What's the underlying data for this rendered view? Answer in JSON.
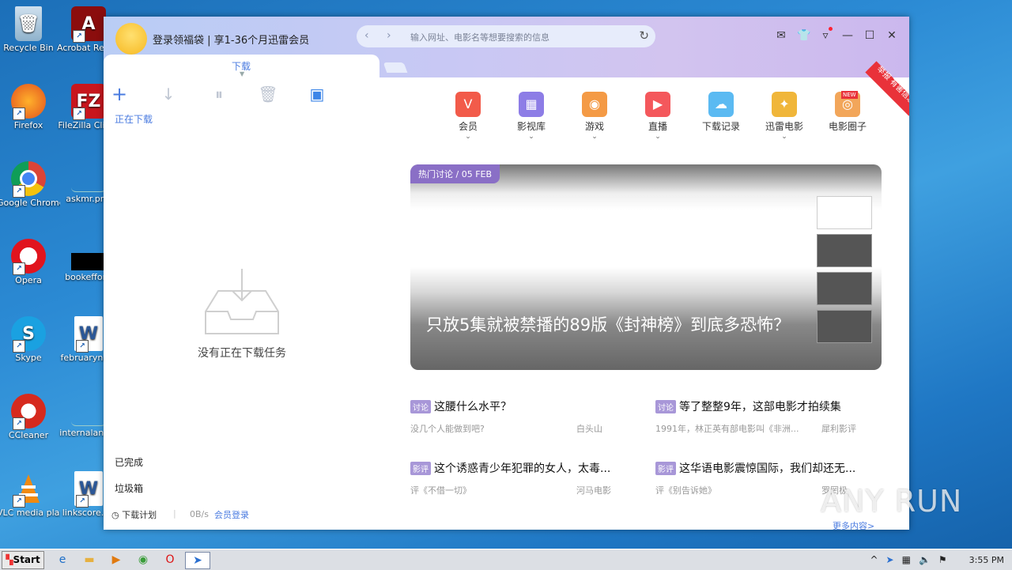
{
  "desktop": {
    "icons": [
      {
        "label": "Recycle Bin",
        "icon": "recycle-bin-icon"
      },
      {
        "label": "Acrobat Reader DC",
        "icon": "acrobat-icon"
      },
      {
        "label": "Firefox",
        "icon": "firefox-icon"
      },
      {
        "label": "FileZilla Client",
        "icon": "filezilla-icon"
      },
      {
        "label": "Google Chrome",
        "icon": "chrome-icon"
      },
      {
        "label": "askmr.png",
        "icon": "image-file-icon"
      },
      {
        "label": "Opera",
        "icon": "opera-icon"
      },
      {
        "label": "bookeffort.",
        "icon": "file-icon"
      },
      {
        "label": "Skype",
        "icon": "skype-icon"
      },
      {
        "label": "februaryna...",
        "icon": "word-doc-icon"
      },
      {
        "label": "CCleaner",
        "icon": "ccleaner-icon"
      },
      {
        "label": "internalang...",
        "icon": "file-icon"
      },
      {
        "label": "VLC media player",
        "icon": "vlc-icon"
      },
      {
        "label": "linkscore.r...",
        "icon": "word-doc-icon"
      }
    ]
  },
  "app": {
    "login_text": "登录领福袋 | 享1-36个月迅雷会员",
    "address_placeholder": "输入网址、电影名等想要搜索的信息",
    "tab_label": "下载",
    "toolbar": {
      "add": "+",
      "more": "•••"
    },
    "sidebar": {
      "active": "正在下载",
      "completed": "已完成",
      "trash": "垃圾箱"
    },
    "empty_text": "没有正在下载任务",
    "bottom": {
      "plan": "下载计划",
      "speed": "0B/s",
      "vip_login": "会员登录"
    },
    "categories": [
      {
        "label": "会员",
        "color": "#f25b4a",
        "glyph": "V"
      },
      {
        "label": "影视库",
        "color": "#8d7de6",
        "glyph": "▦"
      },
      {
        "label": "游戏",
        "color": "#f49a45",
        "glyph": "◉"
      },
      {
        "label": "直播",
        "color": "#f4585c",
        "glyph": "▶"
      },
      {
        "label": "下载记录",
        "color": "#5bbaf2",
        "glyph": "☁"
      },
      {
        "label": "迅雷电影",
        "color": "#f0b63a",
        "glyph": "✦"
      },
      {
        "label": "电影圈子",
        "color": "#f2a65a",
        "glyph": "◎"
      }
    ],
    "new_tag": "NEW",
    "ribbon": "举报 有害信息",
    "banner": {
      "tag": "热门讨论 / 05 FEB",
      "headline": "只放5集就被禁播的89版《封神榜》到底多恐怖？"
    },
    "news": [
      {
        "badge": "讨论",
        "title": "这腰什么水平？",
        "sub": "没几个人能做到吧?",
        "source": "白头山"
      },
      {
        "badge": "讨论",
        "title": "等了整整9年，这部电影才拍续集",
        "sub": "1991年，林正英有部电影叫《非洲...",
        "source": "犀利影评"
      },
      {
        "badge": "影评",
        "title": "这个诱惑青少年犯罪的女人，太毒...",
        "sub": "评《不借一切》",
        "source": "河马电影"
      },
      {
        "badge": "影评",
        "title": "这华语电影震惊国际，我们却还无...",
        "sub": "评《别告诉她》",
        "source": "罗罔极"
      }
    ],
    "more": "更多内容>"
  },
  "watermark": "ANY RUN",
  "taskbar": {
    "start": "Start",
    "time": "3:55 PM"
  }
}
